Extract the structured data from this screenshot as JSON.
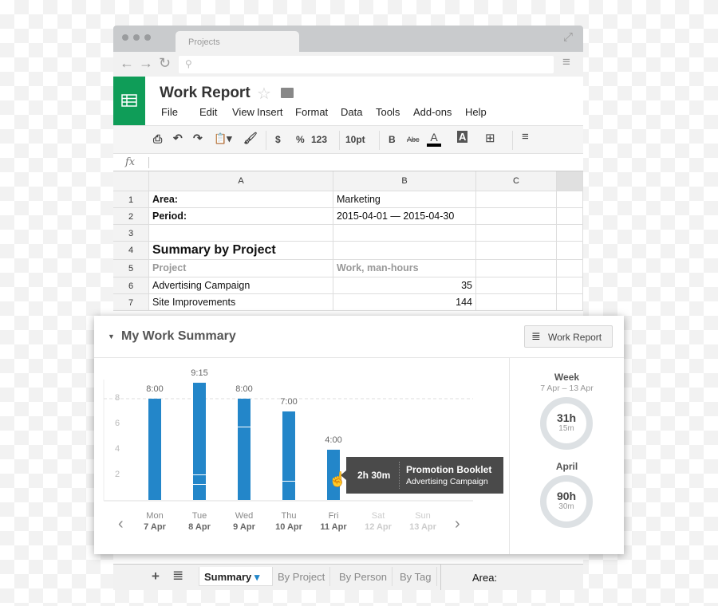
{
  "browser": {
    "tab_title": "Projects"
  },
  "doc": {
    "title": "Work Report",
    "menu": [
      "File",
      "Edit",
      "View",
      "Insert",
      "Format",
      "Data",
      "Tools",
      "Add-ons",
      "Help"
    ]
  },
  "toolbar": {
    "number_format": "123",
    "font_size": "10pt",
    "currency": "$",
    "percent": "%",
    "bold": "B",
    "strikethrough": "Abc",
    "text_color": "A",
    "fill_color": "A"
  },
  "formula": {
    "fx": "fx",
    "value": ""
  },
  "sheet": {
    "columns": [
      "A",
      "B",
      "C"
    ],
    "rows": [
      {
        "n": "1",
        "a": "Area:",
        "b": "Marketing",
        "style": "bold"
      },
      {
        "n": "2",
        "a": "Period:",
        "b": "2015-04-01 — 2015-04-30",
        "style": "bold"
      },
      {
        "n": "3",
        "a": "",
        "b": ""
      },
      {
        "n": "4",
        "a": "Summary by Project",
        "b": "",
        "style": "big"
      },
      {
        "n": "5",
        "a": "Project",
        "b": "Work, man-hours",
        "style": "head"
      },
      {
        "n": "6",
        "a": "Advertising Campaign",
        "b": "35"
      },
      {
        "n": "7",
        "a": "Site Improvements",
        "b": "144"
      }
    ]
  },
  "panel": {
    "title": "My Work Summary",
    "button": "Work Report",
    "week": {
      "label": "Week",
      "range": "7 Apr – 13 Apr",
      "hours": "31h",
      "minutes": "15m"
    },
    "month": {
      "label": "April",
      "hours": "90h",
      "minutes": "30m"
    },
    "tooltip": {
      "duration": "2h 30m",
      "task": "Promotion Booklet",
      "project": "Advertising Campaign"
    }
  },
  "chart_data": {
    "type": "bar",
    "stacked": true,
    "ylim": [
      0,
      9.5
    ],
    "yticks": [
      "2",
      "4",
      "6",
      "8"
    ],
    "reference_line": 8,
    "bar_color": "#2386c9",
    "days": [
      {
        "day": "Mon",
        "date": "7 Apr",
        "label": "8:00",
        "total": 8,
        "segments": [
          4,
          4
        ]
      },
      {
        "day": "Tue",
        "date": "8 Apr",
        "label": "9:15",
        "total": 9.25,
        "segments": [
          1.25,
          0.75,
          2.5,
          4.75
        ]
      },
      {
        "day": "Wed",
        "date": "9 Apr",
        "label": "8:00",
        "total": 8,
        "segments": [
          5.75,
          0.75,
          1.5
        ]
      },
      {
        "day": "Thu",
        "date": "10 Apr",
        "label": "7:00",
        "total": 7,
        "segments": [
          1.5,
          2.25,
          3.25
        ]
      },
      {
        "day": "Fri",
        "date": "11 Apr",
        "label": "4:00",
        "total": 4,
        "segments": [
          2.5,
          1.5
        ]
      },
      {
        "day": "Sat",
        "date": "12 Apr",
        "label": "",
        "total": 0,
        "segments": []
      },
      {
        "day": "Sun",
        "date": "13 Apr",
        "label": "",
        "total": 0,
        "segments": []
      }
    ]
  },
  "sheet_tabs": {
    "tabs": [
      "Summary",
      "By Project",
      "By Person",
      "By Tag"
    ],
    "active": "Summary",
    "status": "Area:"
  }
}
